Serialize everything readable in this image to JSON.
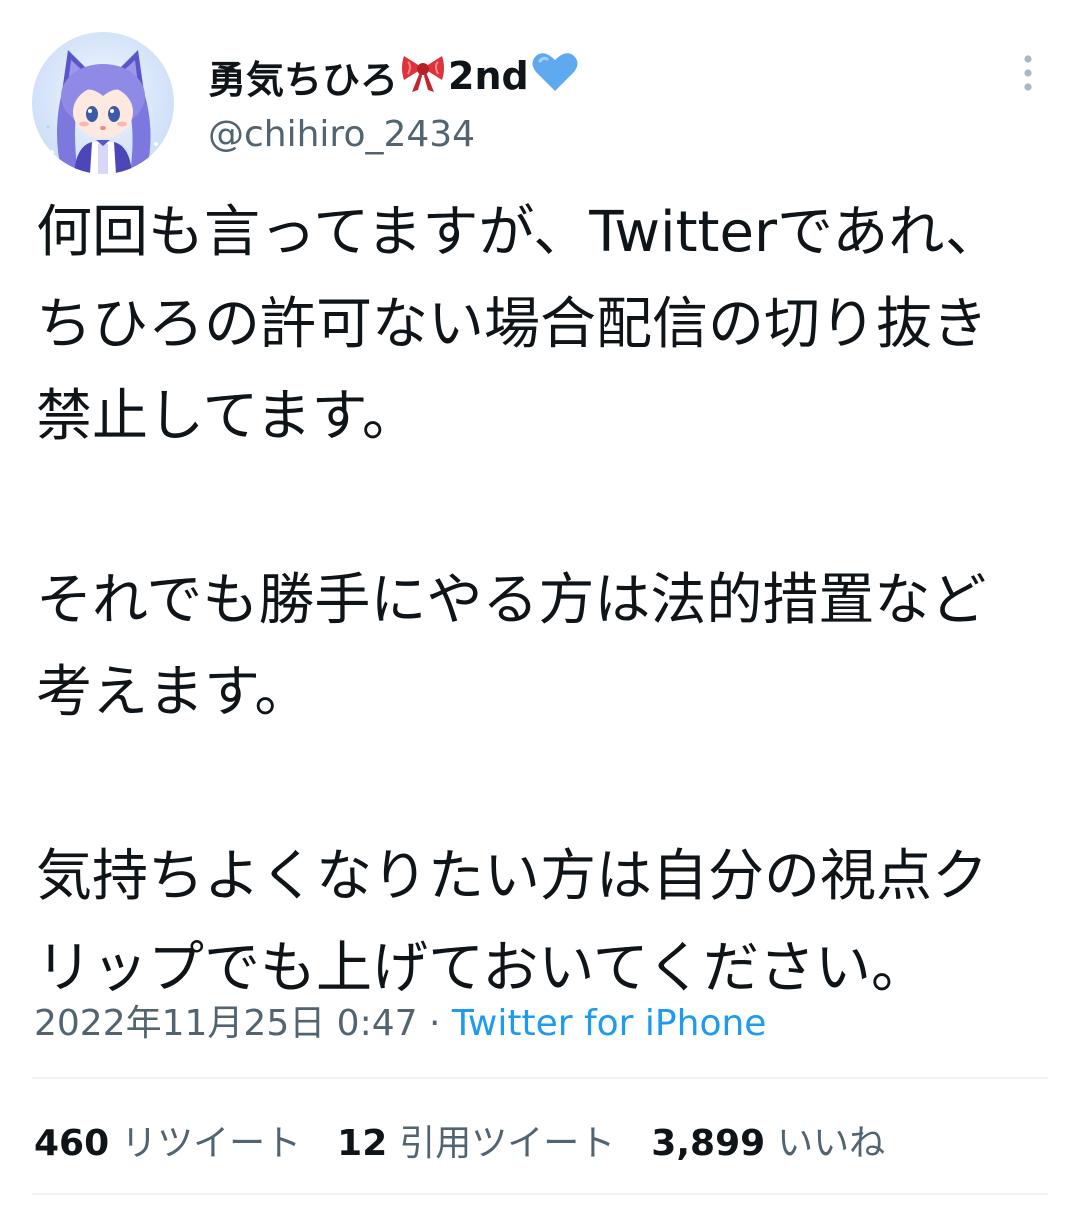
{
  "user": {
    "display_name": "勇気ちひろ",
    "name_suffix": "2nd",
    "name_emojis": [
      "ribbon-emoji",
      "blue-heart-emoji"
    ],
    "handle": "@chihiro_2434"
  },
  "tweet": {
    "text": "何回も言ってますが、Twitterであれ、ちひろの許可ない場合配信の切り抜き禁止してます。\n\nそれでも勝手にやる方は法的措置など考えます。\n\n気持ちよくなりたい方は自分の視点クリップでも上げておいてください。",
    "datetime": "2022年11月25日 0:47",
    "separator": " · ",
    "source": "Twitter for iPhone"
  },
  "stats": {
    "retweets": {
      "value": "460",
      "label": "リツイート"
    },
    "quotes": {
      "value": "12",
      "label": "引用ツイート"
    },
    "likes": {
      "value": "3,899",
      "label": "いいね"
    }
  },
  "colors": {
    "text": "#0f1419",
    "secondary": "#536471",
    "link": "#1d9bf0",
    "divider": "#eff3f4",
    "heart": "#5ea9ef",
    "ribbon": "#e0323a"
  }
}
